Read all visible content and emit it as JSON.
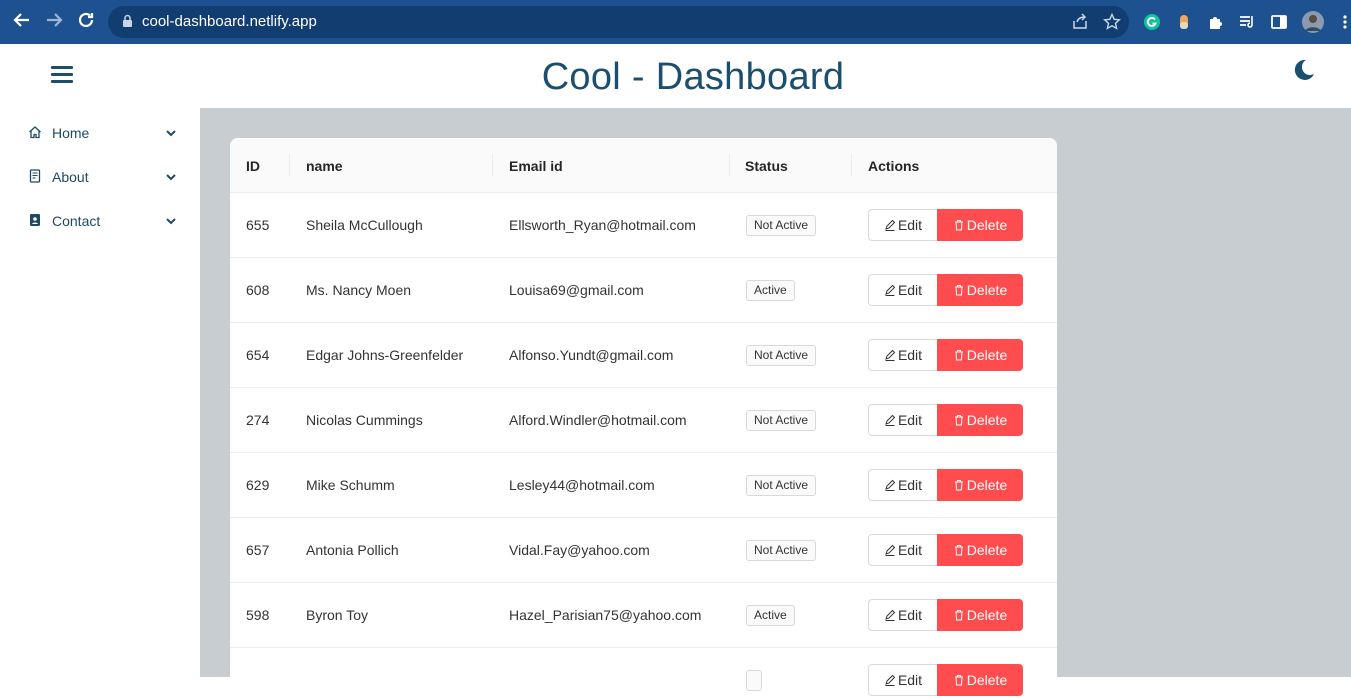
{
  "browser": {
    "url": "cool-dashboard.netlify.app"
  },
  "header": {
    "title": "Cool - Dashboard"
  },
  "sidebar": {
    "items": [
      {
        "label": "Home",
        "icon": "home-icon"
      },
      {
        "label": "About",
        "icon": "about-icon"
      },
      {
        "label": "Contact",
        "icon": "contact-icon"
      }
    ]
  },
  "table": {
    "columns": [
      "ID",
      "name",
      "Email id",
      "Status",
      "Actions"
    ],
    "edit_label": "Edit",
    "delete_label": "Delete",
    "rows": [
      {
        "id": "655",
        "name": "Sheila McCullough",
        "email": "Ellsworth_Ryan@hotmail.com",
        "status": "Not Active"
      },
      {
        "id": "608",
        "name": "Ms. Nancy Moen",
        "email": "Louisa69@gmail.com",
        "status": "Active"
      },
      {
        "id": "654",
        "name": "Edgar Johns-Greenfelder",
        "email": "Alfonso.Yundt@gmail.com",
        "status": "Not Active"
      },
      {
        "id": "274",
        "name": "Nicolas Cummings",
        "email": "Alford.Windler@hotmail.com",
        "status": "Not Active"
      },
      {
        "id": "629",
        "name": "Mike Schumm",
        "email": "Lesley44@hotmail.com",
        "status": "Not Active"
      },
      {
        "id": "657",
        "name": "Antonia Pollich",
        "email": "Vidal.Fay@yahoo.com",
        "status": "Not Active"
      },
      {
        "id": "598",
        "name": "Byron Toy",
        "email": "Hazel_Parisian75@yahoo.com",
        "status": "Active"
      }
    ]
  },
  "colors": {
    "chrome": "#1d5190",
    "title": "#1b4f6e",
    "main_bg": "#c8cdd1",
    "delete": "#ff4d4f"
  }
}
